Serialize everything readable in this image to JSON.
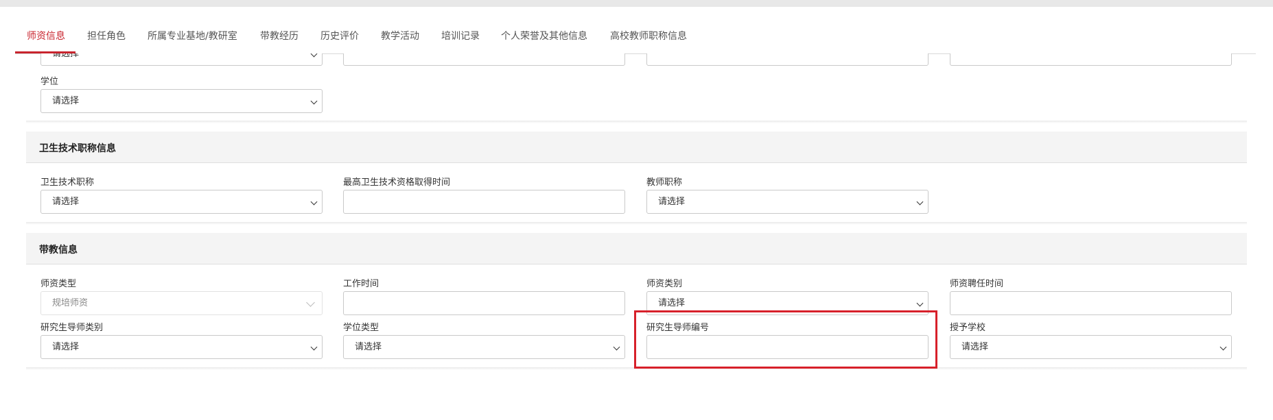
{
  "tabs": [
    {
      "label": "师资信息",
      "active": true
    },
    {
      "label": "担任角色"
    },
    {
      "label": "所属专业基地/教研室"
    },
    {
      "label": "带教经历"
    },
    {
      "label": "历史评价"
    },
    {
      "label": "教学活动"
    },
    {
      "label": "培训记录"
    },
    {
      "label": "个人荣誉及其他信息"
    },
    {
      "label": "高校教师职称信息"
    }
  ],
  "education": {
    "partial_select_value": "请选择",
    "degree_label": "学位",
    "degree_value": "请选择"
  },
  "health_title": {
    "section_title": "卫生技术职称信息",
    "fields": {
      "title_label": "卫生技术职称",
      "title_value": "请选择",
      "highest_time_label": "最高卫生技术资格取得时间",
      "highest_time_value": "",
      "teacher_title_label": "教师职称",
      "teacher_title_value": "请选择"
    }
  },
  "teaching": {
    "section_title": "带教信息",
    "fields": {
      "faculty_type_label": "师资类型",
      "faculty_type_value": "规培师资",
      "work_time_label": "工作时间",
      "work_time_value": "",
      "faculty_category_label": "师资类别",
      "faculty_category_value": "请选择",
      "hire_time_label": "师资聘任时间",
      "hire_time_value": "",
      "supervisor_category_label": "研究生导师类别",
      "supervisor_category_value": "请选择",
      "degree_type_label": "学位类型",
      "degree_type_value": "请选择",
      "supervisor_no_label": "研究生导师编号",
      "supervisor_no_value": "",
      "grant_school_label": "授予学校",
      "grant_school_value": "请选择"
    }
  },
  "colors": {
    "accent": "#c8242d",
    "highlight": "#d7202a"
  }
}
